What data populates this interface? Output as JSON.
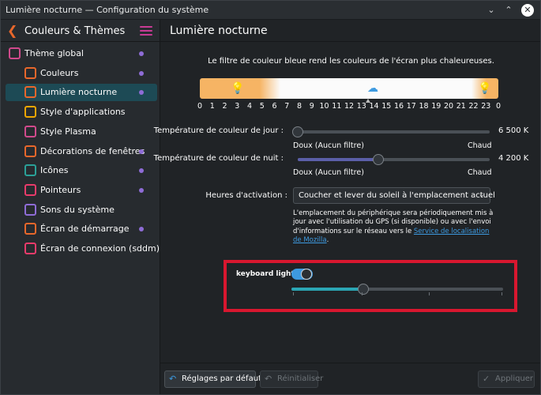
{
  "window": {
    "title": "Lumière nocturne — Configuration du système"
  },
  "sidebar": {
    "header": "Couleurs & Thèmes",
    "items": [
      {
        "label": "Thème global",
        "icon": "global-theme-icon",
        "color": "#d04a8c",
        "dot": true,
        "active": false
      },
      {
        "label": "Couleurs",
        "icon": "colors-icon",
        "color": "#e8672b",
        "dot": true,
        "active": false
      },
      {
        "label": "Lumière nocturne",
        "icon": "night-light-icon",
        "color": "#e8672b",
        "dot": true,
        "active": true
      },
      {
        "label": "Style d'applications",
        "icon": "app-style-icon",
        "color": "#f0a500",
        "dot": false,
        "active": false
      },
      {
        "label": "Style Plasma",
        "icon": "plasma-style-icon",
        "color": "#d04a8c",
        "dot": false,
        "active": false
      },
      {
        "label": "Décorations de fenêtres",
        "icon": "window-decorations-icon",
        "color": "#e8672b",
        "dot": true,
        "active": false
      },
      {
        "label": "Icônes",
        "icon": "icons-icon",
        "color": "#2aa198",
        "dot": true,
        "active": false
      },
      {
        "label": "Pointeurs",
        "icon": "cursors-icon",
        "color": "#e83b6a",
        "dot": true,
        "active": false
      },
      {
        "label": "Sons du système",
        "icon": "system-sounds-icon",
        "color": "#8e6cd6",
        "dot": false,
        "active": false
      },
      {
        "label": "Écran de démarrage",
        "icon": "splash-screen-icon",
        "color": "#e8672b",
        "dot": true,
        "active": false
      },
      {
        "label": "Écran de connexion (sddm)",
        "icon": "login-screen-icon",
        "color": "#e83b6a",
        "dot": false,
        "active": false
      }
    ]
  },
  "main": {
    "title": "Lumière nocturne",
    "description": "Le filtre de couleur bleue rend les couleurs de l'écran plus chaleureuses.",
    "hours": [
      "0",
      "1",
      "2",
      "3",
      "4",
      "5",
      "6",
      "7",
      "8",
      "9",
      "10",
      "11",
      "12",
      "13",
      "14",
      "15",
      "16",
      "17",
      "18",
      "19",
      "20",
      "21",
      "22",
      "23",
      "0"
    ],
    "day_temp": {
      "label": "Température de couleur de jour :",
      "value": "6 500 K",
      "min_label": "Doux (Aucun filtre)",
      "max_label": "Chaud",
      "level": 0.0
    },
    "night_temp": {
      "label": "Température de couleur de nuit :",
      "value": "4 200 K",
      "min_label": "Doux (Aucun filtre)",
      "max_label": "Chaud",
      "level": 0.42
    },
    "activation": {
      "label": "Heures d'activation :",
      "selected": "Coucher et lever du soleil à l'emplacement actuel"
    },
    "info_text": "L'emplacement du périphérique sera périodiquement mis à jour avec l'utilisation du GPS (si disponible) ou avec l'envoi d'informations sur le réseau vers le",
    "info_link": "Service de localisation de Mozilla",
    "info_end": ".",
    "keyboard": {
      "label": "keyboard light :",
      "enabled": true,
      "level": 0.34
    }
  },
  "footer": {
    "defaults": "Réglages par défaut",
    "reset": "Réinitialiser",
    "apply": "Appliquer"
  }
}
